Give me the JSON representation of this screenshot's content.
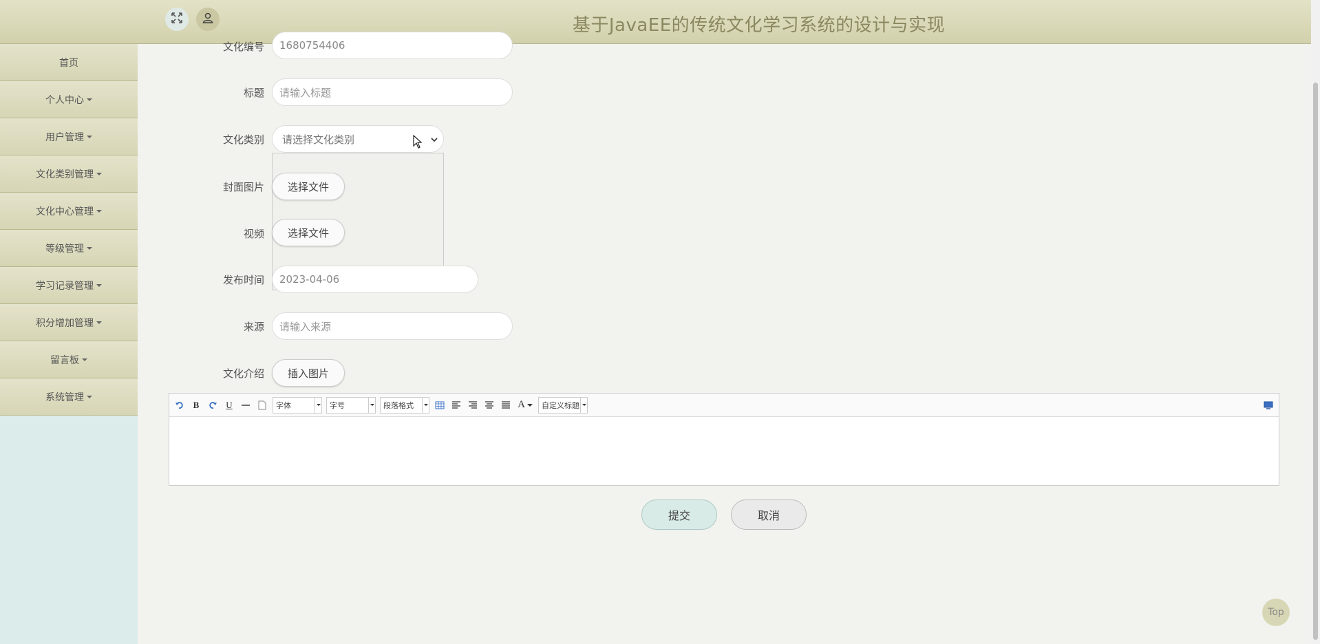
{
  "header": {
    "title": "基于JavaEE的传统文化学习系统的设计与实现",
    "expand_icon": "expand-icon",
    "user_icon": "user-icon"
  },
  "sidebar": {
    "items": [
      {
        "label": "首页",
        "dropdown": false
      },
      {
        "label": "个人中心",
        "dropdown": true
      },
      {
        "label": "用户管理",
        "dropdown": true
      },
      {
        "label": "文化类别管理",
        "dropdown": true
      },
      {
        "label": "文化中心管理",
        "dropdown": true
      },
      {
        "label": "等级管理",
        "dropdown": true
      },
      {
        "label": "学习记录管理",
        "dropdown": true
      },
      {
        "label": "积分增加管理",
        "dropdown": true
      },
      {
        "label": "留言板",
        "dropdown": true
      },
      {
        "label": "系统管理",
        "dropdown": true
      }
    ]
  },
  "form": {
    "culture_no": {
      "label": "文化编号",
      "value": "1680754406"
    },
    "title": {
      "label": "标题",
      "placeholder": "请输入标题"
    },
    "category": {
      "label": "文化类别",
      "placeholder": "请选择文化类别"
    },
    "cover": {
      "label": "封面图片",
      "button": "选择文件"
    },
    "video": {
      "label": "视频",
      "button": "选择文件"
    },
    "publish_time": {
      "label": "发布时间",
      "value": "2023-04-06"
    },
    "source": {
      "label": "来源",
      "placeholder": "请输入来源"
    },
    "intro": {
      "label": "文化介绍",
      "button": "插入图片"
    }
  },
  "editor": {
    "font_combo": "字体",
    "size_combo": "字号",
    "paragraph_combo": "段落格式",
    "custom_title_combo": "自定义标题",
    "font_color_glyph": "A"
  },
  "actions": {
    "submit": "提交",
    "cancel": "取消",
    "top": "Top"
  }
}
